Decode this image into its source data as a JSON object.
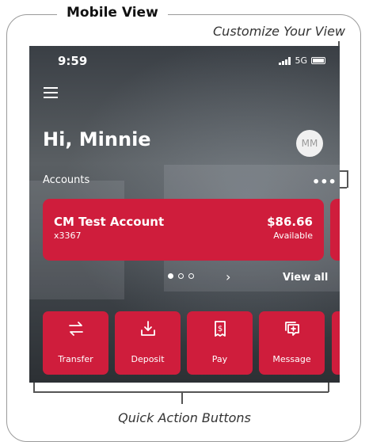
{
  "annotation": {
    "frame_title": "Mobile View",
    "customize": "Customize Your View",
    "quick_actions": "Quick Action Buttons"
  },
  "status_bar": {
    "time": "9:59",
    "network": "5G"
  },
  "header": {
    "greeting": "Hi, Minnie",
    "avatar_initials": "MM"
  },
  "accounts": {
    "label": "Accounts",
    "more_icon": "ellipsis-icon",
    "card": {
      "name": "CM Test Account",
      "number": "x3367",
      "balance": "$86.66",
      "balance_label": "Available"
    },
    "view_all": "View all",
    "carousel_pages": 3,
    "carousel_active": 1
  },
  "quick_actions": [
    {
      "label": "Transfer",
      "icon": "transfer-icon"
    },
    {
      "label": "Deposit",
      "icon": "deposit-icon"
    },
    {
      "label": "Pay",
      "icon": "pay-icon"
    },
    {
      "label": "Message",
      "icon": "message-icon"
    }
  ],
  "colors": {
    "brand_red": "#cf1d3c",
    "text_white": "#ffffff"
  }
}
